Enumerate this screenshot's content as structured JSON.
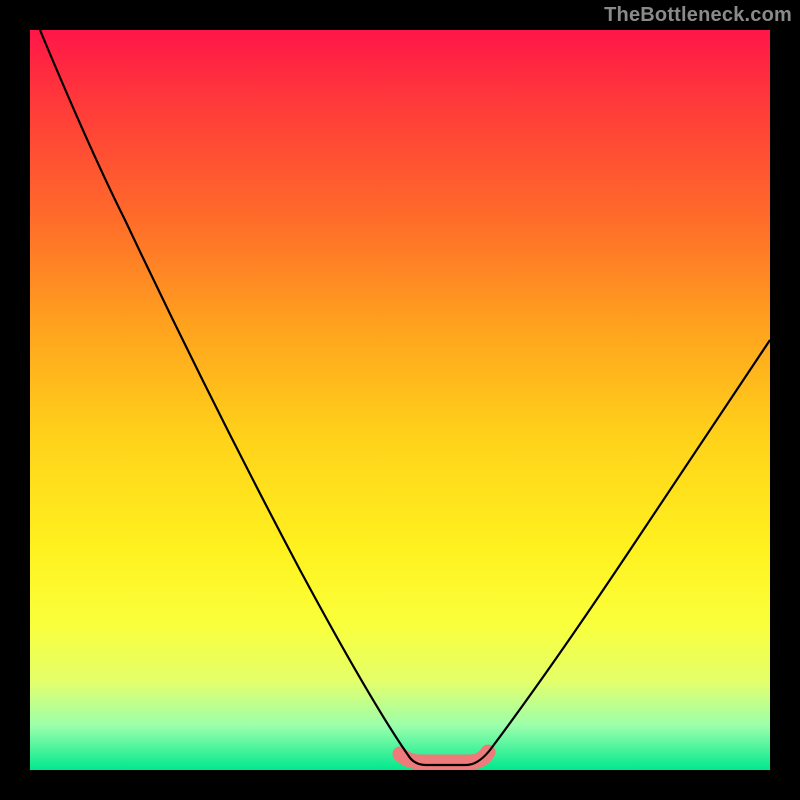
{
  "watermark": {
    "text": "TheBottleneck.com"
  },
  "chart_data": {
    "type": "line",
    "title": "",
    "xlabel": "",
    "ylabel": "",
    "xlim": [
      0,
      100
    ],
    "ylim": [
      0,
      100
    ],
    "x": [
      0,
      5,
      10,
      15,
      20,
      25,
      30,
      35,
      40,
      45,
      50,
      53,
      56,
      58,
      60,
      65,
      70,
      75,
      80,
      85,
      90,
      95,
      100
    ],
    "values": [
      100,
      92,
      84,
      74,
      63,
      52,
      41,
      30,
      20,
      11,
      4,
      1,
      0,
      0,
      1,
      5,
      11,
      18,
      26,
      34,
      42,
      50,
      58
    ],
    "background_gradient": {
      "0": "#ff1648",
      "50": "#ffd21a",
      "100": "#00e88e"
    },
    "highlight_band": {
      "color": "#ef7a7a",
      "x_start": 50,
      "x_end": 60,
      "y": 1
    }
  }
}
